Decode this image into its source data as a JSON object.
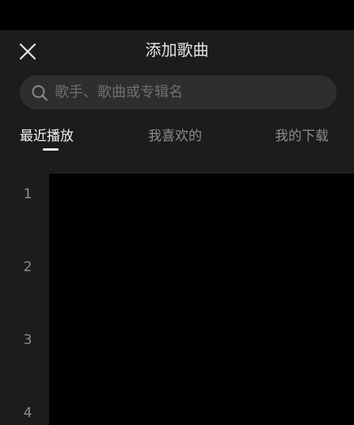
{
  "header": {
    "title": "添加歌曲",
    "close_icon": "close-x-icon"
  },
  "search": {
    "placeholder": "歌手、歌曲或专辑名",
    "value": "",
    "icon": "search-icon"
  },
  "tabs": [
    {
      "label": "最近播放",
      "active": true
    },
    {
      "label": "我喜欢的",
      "active": false
    },
    {
      "label": "我的下载",
      "active": false
    }
  ],
  "rows": [
    {
      "index": "1"
    },
    {
      "index": "2"
    },
    {
      "index": "3"
    },
    {
      "index": "4"
    }
  ],
  "colors": {
    "background": "#1c1c1c",
    "active_tab": "#f2f2f2",
    "inactive_tab": "#8d8d8d",
    "search_bg": "#2e2e2e"
  }
}
